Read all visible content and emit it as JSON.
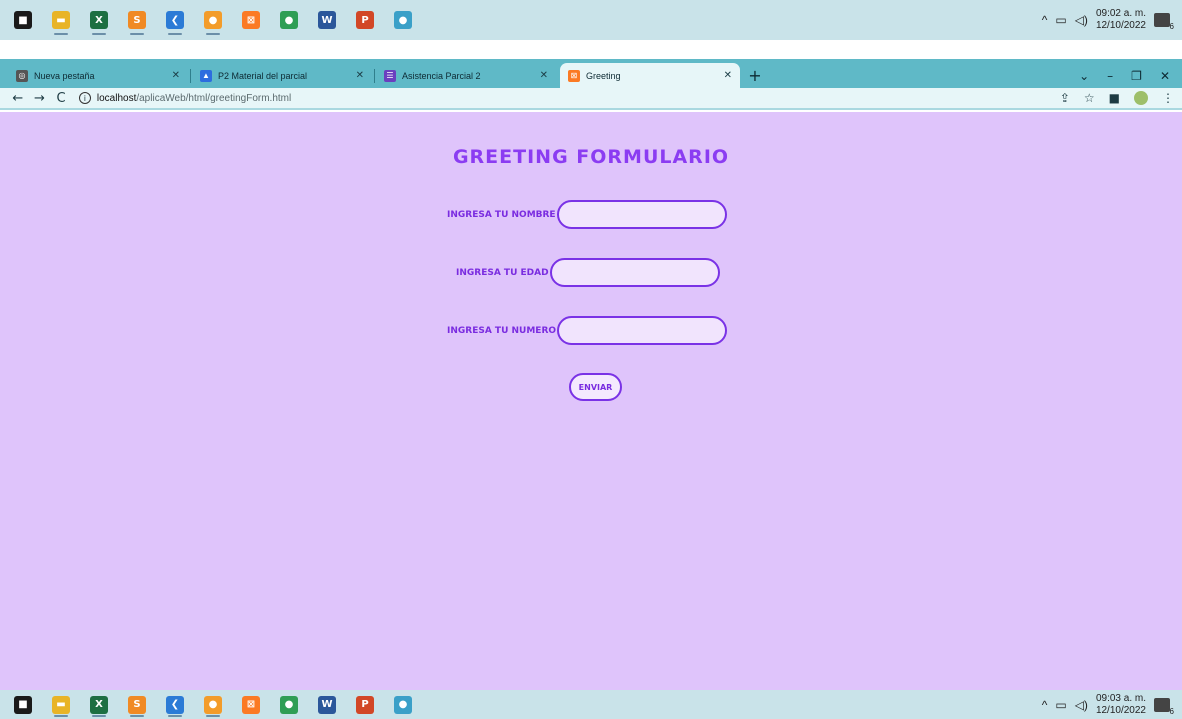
{
  "taskbar": {
    "apps": [
      {
        "icon": "start-icon",
        "glyph": "■",
        "color": "#1a1a1a"
      },
      {
        "icon": "file-explorer-icon",
        "glyph": "▬",
        "color": "#e8b427"
      },
      {
        "icon": "excel-icon",
        "glyph": "X",
        "color": "#1d6f42"
      },
      {
        "icon": "sublime-text-icon",
        "glyph": "S",
        "color": "#f08a24"
      },
      {
        "icon": "vscode-icon",
        "glyph": "❮",
        "color": "#2b7bd6"
      },
      {
        "icon": "firefox-icon",
        "glyph": "●",
        "color": "#f39c2a"
      },
      {
        "icon": "xampp-icon",
        "glyph": "⊠",
        "color": "#fb7a24"
      },
      {
        "icon": "chrome-icon",
        "glyph": "●",
        "color": "#2f9e55"
      },
      {
        "icon": "word-icon",
        "glyph": "W",
        "color": "#2b579a"
      },
      {
        "icon": "powerpoint-icon",
        "glyph": "P",
        "color": "#d24726"
      },
      {
        "icon": "chrome-canary-icon",
        "glyph": "●",
        "color": "#3aa0c8"
      }
    ],
    "top_time": "09:02 a. m.",
    "top_date": "12/10/2022",
    "bottom_time": "09:03 a. m.",
    "bottom_date": "12/10/2022"
  },
  "browser": {
    "tabs": [
      {
        "title": "Nueva pestaña",
        "favicon_color": "#555555",
        "favicon_glyph": "◎",
        "active": false
      },
      {
        "title": "P2 Material del parcial",
        "favicon_color": "#2d6cdf",
        "favicon_glyph": "▲",
        "active": false
      },
      {
        "title": "Asistencia Parcial 2",
        "favicon_color": "#6b3fbf",
        "favicon_glyph": "☰",
        "active": false
      },
      {
        "title": "Greeting",
        "favicon_color": "#fb7a24",
        "favicon_glyph": "⊠",
        "active": true
      }
    ],
    "url_host": "localhost",
    "url_path": "/aplicaWeb/html/greetingForm.html"
  },
  "form": {
    "title": "Greeting Formulario",
    "fields": [
      {
        "label": "Ingresa tu nombre",
        "value": ""
      },
      {
        "label": "Ingresa tu edad",
        "value": ""
      },
      {
        "label": "Ingresa tu numero",
        "value": ""
      }
    ],
    "submit_label": "Enviar"
  },
  "colors": {
    "page_bg": "#dfc4fb",
    "accent": "#8b3cf2",
    "tabstrip": "#5fb9c7"
  }
}
